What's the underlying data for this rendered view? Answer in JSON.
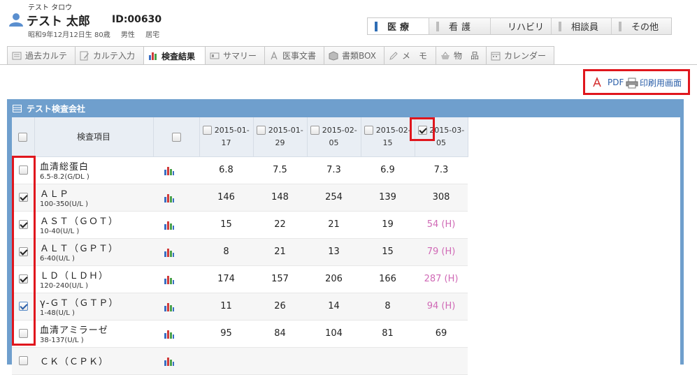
{
  "patient": {
    "kana": "テスト タロウ",
    "name": "テスト 太郎",
    "id": "ID:00630",
    "birth": "昭和9年12月12日生 80歳",
    "gender": "男性",
    "residence": "居宅"
  },
  "departments": [
    {
      "label": "医療",
      "active": true
    },
    {
      "label": "看護",
      "active": false
    },
    {
      "label": "リハビリ",
      "active": false
    },
    {
      "label": "相談員",
      "active": false
    },
    {
      "label": "その他",
      "active": false
    }
  ],
  "tabs": [
    {
      "label": "過去カルテ",
      "icon": "folder-icon",
      "active": false
    },
    {
      "label": "カルテ入力",
      "icon": "edit-icon",
      "active": false
    },
    {
      "label": "検査結果",
      "icon": "bar-chart-icon",
      "active": true
    },
    {
      "label": "サマリー",
      "icon": "id-card-icon",
      "active": false
    },
    {
      "label": "医事文書",
      "icon": "pdf-icon",
      "active": false
    },
    {
      "label": "書類BOX",
      "icon": "box-icon",
      "active": false
    },
    {
      "label": "メ　モ",
      "icon": "pencil-icon",
      "active": false
    },
    {
      "label": "物　品",
      "icon": "basket-icon",
      "active": false
    },
    {
      "label": "カレンダー",
      "icon": "calendar-icon",
      "active": false
    }
  ],
  "actions": {
    "pdf_label": "PDF",
    "print_label": "印刷用画面"
  },
  "panel": {
    "title": "テスト検査会社",
    "item_header": "検査項目"
  },
  "dates": [
    {
      "line1": "2015-01-",
      "line2": "17",
      "checked": false
    },
    {
      "line1": "2015-01-",
      "line2": "29",
      "checked": false
    },
    {
      "line1": "2015-02-",
      "line2": "05",
      "checked": false
    },
    {
      "line1": "2015-02-",
      "line2": "15",
      "checked": false
    },
    {
      "line1": "2015-03-",
      "line2": "05",
      "checked": true
    }
  ],
  "rows": [
    {
      "name": "血清総蛋白",
      "ref": "6.5-8.2(G/DL )",
      "checked": false,
      "values": [
        "6.8",
        "7.5",
        "7.3",
        "6.9",
        "7.3"
      ],
      "high": [
        false,
        false,
        false,
        false,
        false
      ]
    },
    {
      "name": "ＡＬＰ",
      "ref": "100-350(U/L )",
      "checked": true,
      "values": [
        "146",
        "148",
        "254",
        "139",
        "308"
      ],
      "high": [
        false,
        false,
        false,
        false,
        false
      ]
    },
    {
      "name": "ＡＳＴ（ＧＯＴ）",
      "ref": "10-40(U/L )",
      "checked": true,
      "values": [
        "15",
        "22",
        "21",
        "19",
        "54 (H)"
      ],
      "high": [
        false,
        false,
        false,
        false,
        true
      ]
    },
    {
      "name": "ＡＬＴ（ＧＰＴ）",
      "ref": "6-40(U/L )",
      "checked": true,
      "values": [
        "8",
        "21",
        "13",
        "15",
        "79 (H)"
      ],
      "high": [
        false,
        false,
        false,
        false,
        true
      ]
    },
    {
      "name": "ＬＤ（ＬＤＨ）",
      "ref": "120-240(U/L )",
      "checked": true,
      "values": [
        "174",
        "157",
        "206",
        "166",
        "287 (H)"
      ],
      "high": [
        false,
        false,
        false,
        false,
        true
      ]
    },
    {
      "name": "γ-ＧＴ（ＧＴＰ）",
      "ref": "1-48(U/L )",
      "checked": true,
      "focused": true,
      "values": [
        "11",
        "26",
        "14",
        "8",
        "94 (H)"
      ],
      "high": [
        false,
        false,
        false,
        false,
        true
      ]
    },
    {
      "name": "血清アミラーゼ",
      "ref": "38-137(U/L )",
      "checked": false,
      "values": [
        "95",
        "84",
        "104",
        "81",
        "69"
      ],
      "high": [
        false,
        false,
        false,
        false,
        false
      ]
    },
    {
      "name": "ＣＫ（ＣＰＫ）",
      "ref": "",
      "checked": false,
      "values": [
        "",
        "",
        "",
        "",
        ""
      ],
      "high": [
        false,
        false,
        false,
        false,
        false
      ]
    }
  ],
  "colors": {
    "accent": "#2f6db5",
    "panel": "#6f9fcd",
    "high_value": "#d06ab6",
    "highlight_box": "#e0161d"
  }
}
